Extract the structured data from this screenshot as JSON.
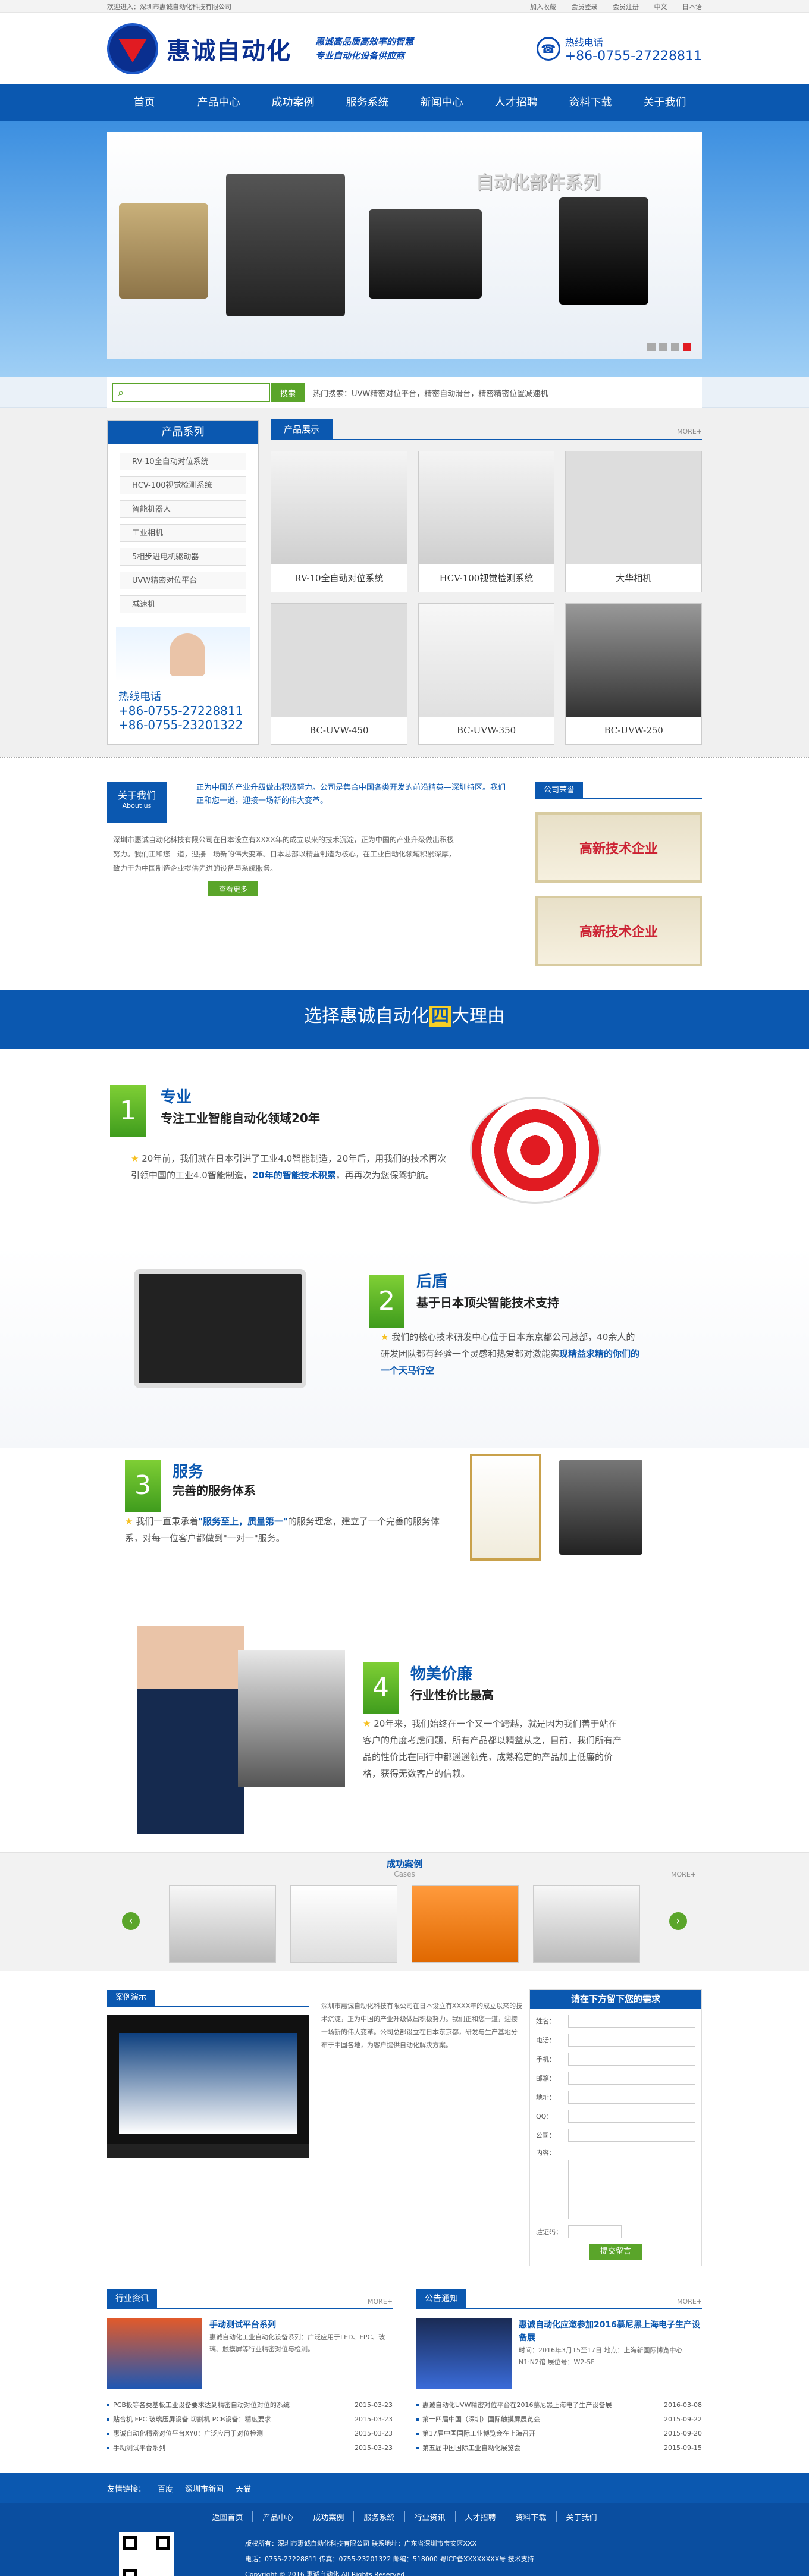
{
  "topbar": {
    "welcome": "欢迎进入：深圳市惠诚自动化科技有限公司",
    "links": [
      "加入收藏",
      "会员登录",
      "会员注册",
      "中文",
      "日本语"
    ]
  },
  "header": {
    "logo_name": "惠诚自动化",
    "slogan_line1": "惠诚高品质高效率的智慧",
    "slogan_line2": "专业自动化设备供应商",
    "hotline_label": "热线电话",
    "hotline_number": "+86-0755-27228811"
  },
  "nav": [
    "首页",
    "产品中心",
    "成功案例",
    "服务系统",
    "新闻中心",
    "人才招聘",
    "资料下载",
    "关于我们"
  ],
  "banner": {
    "title": "自动化部件系列"
  },
  "search": {
    "button": "搜索",
    "hot_label": "热门搜索：UVW精密对位平台，精密自动滑台，精密精密位置减速机"
  },
  "sidebar": {
    "title": "产品系列",
    "items": [
      "RV-10全自动对位系统",
      "HCV-100视觉检测系统",
      "智能机器人",
      "工业相机",
      "5相步进电机驱动器",
      "UVW精密对位平台",
      "减速机"
    ],
    "tel_label": "热线电话",
    "tel1": "+86-0755-27228811",
    "tel2": "+86-0755-23201322"
  },
  "products": {
    "tab": "产品展示",
    "more": "MORE+",
    "items": [
      "RV-10全自动对位系统",
      "HCV-100视觉检测系统",
      "大华相机",
      "BC-UVW-450",
      "BC-UVW-350",
      "BC-UVW-250"
    ]
  },
  "about": {
    "tag": "关于我们",
    "tag_en": "About us",
    "intro": "正为中国的产业升级做出积极努力。公司是集合中国各类开发的前沿精英—深圳特区。我们正和您一道，迎接一场新的伟大变革。",
    "text": "深圳市惠诚自动化科技有限公司在日本设立有XXXX年的成立以来的技术沉淀，正为中国的产业升级做出积极努力。我们正和您一道，迎接一场新的伟大变革。日本总部以精益制造为核心，在工业自动化领域积累深厚，致力于为中国制造企业提供先进的设备与系统服务。",
    "button": "查看更多",
    "honor_title": "公司荣誉",
    "honor_text": "高新技术企业"
  },
  "reasons": {
    "heading_pre": "选择惠诚自动化",
    "heading_num": "四",
    "heading_post": "大理由",
    "r1": {
      "num": "1",
      "title": "专业",
      "sub": "专注工业智能自动化领域20年",
      "text": "20年前，我们就在日本引进了工业4.0智能制造，20年后，用我们的技术再次引领中国的工业4.0智能制造，",
      "hl": "20年的智能技术积累",
      "tail": "，再再次为您保驾护航。"
    },
    "r2": {
      "num": "2",
      "title": "后盾",
      "sub": "基于日本顶尖智能技术支持",
      "text": "我们的核心技术研发中心位于日本东京都公司总部，40余人的研发团队都有经验一个灵感和热爱都对激能实",
      "hl": "现精益求精的你们的一个天马行空",
      "tail": ""
    },
    "r3": {
      "num": "3",
      "title": "服务",
      "sub": "完善的服务体系",
      "text": "我们一直秉承着",
      "hl": "\"服务至上，质量第一\"",
      "tail": "的服务理念，建立了一个完善的服务体系，对每一位客户都做到\"一对一\"服务。"
    },
    "r4": {
      "num": "4",
      "title": "物美价廉",
      "sub": "行业性价比最高",
      "text": "20年来，我们始终在一个又一个跨越，就是因为我们善于站在客户的角度考虑问题，所有产品都以精益从之，目前，我们所有产品的性价比在同行中都遥遥领先，成熟稳定的产品加上低廉的价格，获得无数客户的信赖。",
      "hl": "",
      "tail": ""
    }
  },
  "cases": {
    "title": "成功案例",
    "sub": "Cases",
    "more": "MORE+"
  },
  "video": {
    "tab": "案例演示",
    "text": "深圳市惠诚自动化科技有限公司在日本设立有XXXX年的成立以来的技术沉淀，正为中国的产业升级做出积极努力。我们正和您一道，迎接一场新的伟大变革。公司总部设立在日本东京都，研发与生产基地分布于中国各地，为客户提供自动化解决方案。"
  },
  "message": {
    "title": "请在下方留下您的需求",
    "fields": [
      "姓名：",
      "电话：",
      "手机：",
      "邮箱：",
      "地址：",
      "QQ：",
      "公司：",
      "内容："
    ],
    "captcha_label": "验证码：",
    "submit": "提交留言"
  },
  "news_industry": {
    "tab": "行业资讯",
    "more": "MORE+",
    "top_title": "手动测试平台系列",
    "top_text": "惠诚自动化工业自动化设备系列：广泛应用于LED、FPC、玻璃、触摸屏等行业精密对位与检测。",
    "list": [
      [
        "PCB板等各类基板工业设备要求达到精密自动对位对位的系统",
        "2015-03-23"
      ],
      [
        "贴合机 FPC 玻璃压屏设备 切割机 PCB设备：精度要求",
        "2015-03-23"
      ],
      [
        "惠诚自动化精密对位平台XYθ：广泛应用于对位检测",
        "2015-03-23"
      ],
      [
        "手动测试平台系列",
        "2015-03-23"
      ]
    ]
  },
  "news_company": {
    "tab": "公告通知",
    "more": "MORE+",
    "top_title": "惠诚自动化应邀参加2016慕尼黑上海电子生产设备展",
    "top_text": "时间：2016年3月15至17日 地点：上海新国际博览中心 N1·N2馆 展位号：W2-5F",
    "list": [
      [
        "惠诚自动化UVW精密对位平台在2016慕尼黑上海电子生产设备展",
        "2016-03-08"
      ],
      [
        "第十四届中国（深圳）国际触摸屏展览会",
        "2015-09-22"
      ],
      [
        "第17届中国国际工业博览会在上海召开",
        "2015-09-20"
      ],
      [
        "第五届中国国际工业自动化展览会",
        "2015-09-15"
      ]
    ]
  },
  "friend": {
    "label": "友情链接：",
    "links": [
      "百度",
      "深圳市新闻",
      "天猫"
    ]
  },
  "footer": {
    "nav": [
      "返回首页",
      "产品中心",
      "成功案例",
      "服务系统",
      "行业资讯",
      "人才招聘",
      "资料下载",
      "关于我们"
    ],
    "line1": "版权所有：深圳市惠诚自动化科技有限公司 联系地址：广东省深圳市宝安区XXX",
    "line2": "电话：0755-27228811 传真：0755-23201322 邮编：518000 粤ICP备XXXXXXXX号 技术支持",
    "line3": "Copyright © 2016 惠诚自动化 All Rights Reserved"
  }
}
